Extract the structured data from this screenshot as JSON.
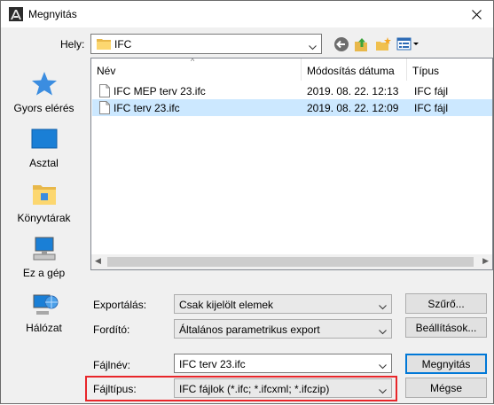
{
  "window": {
    "title": "Megnyitás"
  },
  "lookin": {
    "label": "Hely:",
    "value": "IFC"
  },
  "toolbar": {
    "icons": [
      "back-icon",
      "up-folder-icon",
      "new-folder-icon",
      "view-menu-icon"
    ]
  },
  "places": [
    {
      "label": "Gyors elérés",
      "icon": "star-icon"
    },
    {
      "label": "Asztal",
      "icon": "desktop-icon"
    },
    {
      "label": "Könyvtárak",
      "icon": "libraries-icon"
    },
    {
      "label": "Ez a gép",
      "icon": "computer-icon"
    },
    {
      "label": "Hálózat",
      "icon": "network-icon"
    }
  ],
  "filelist": {
    "columns": [
      "Név",
      "Módosítás dátuma",
      "Típus"
    ],
    "rows": [
      {
        "name": "IFC MEP terv 23.ifc",
        "date": "2019. 08. 22. 12:13",
        "type": "IFC fájl",
        "selected": false
      },
      {
        "name": "IFC terv 23.ifc",
        "date": "2019. 08. 22. 12:09",
        "type": "IFC fájl",
        "selected": true
      }
    ]
  },
  "export": {
    "label": "Exportálás:",
    "value": "Csak kijelölt elemek"
  },
  "translator": {
    "label": "Fordító:",
    "value": "Általános parametrikus export"
  },
  "filename": {
    "label": "Fájlnév:",
    "value": "IFC terv 23.ifc"
  },
  "filetype": {
    "label": "Fájltípus:",
    "value": "IFC fájlok (*.ifc; *.ifcxml; *.ifczip)"
  },
  "buttons": {
    "filter": "Szűrő...",
    "settings": "Beállítások...",
    "open": "Megnyitás",
    "cancel": "Mégse"
  },
  "colors": {
    "selection": "#cce8ff",
    "accent": "#0078d7",
    "highlight": "#e8262a"
  }
}
